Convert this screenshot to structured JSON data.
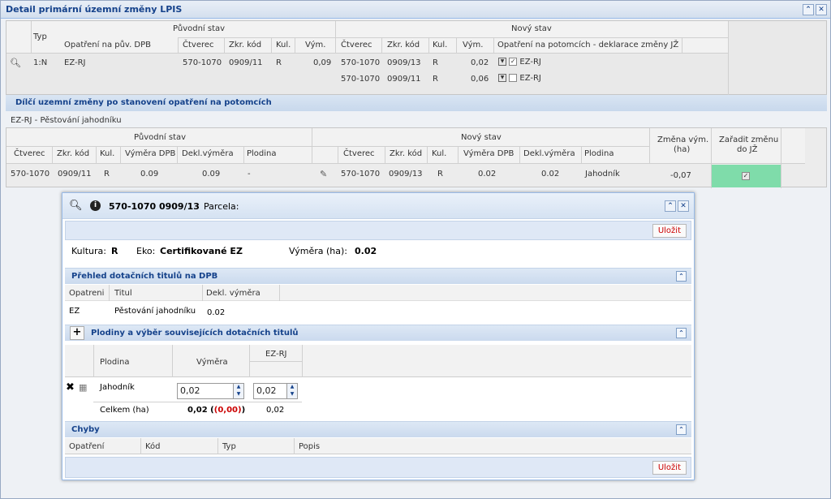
{
  "window": {
    "title": "Detail primární územní změny LPIS"
  },
  "top": {
    "group_original": "Původní stav",
    "group_new": "Nový stav",
    "headers": {
      "typ": "Typ",
      "measure": "Opatření na pův. DPB",
      "ctverec": "Čtverec",
      "zkr": "Zkr. kód",
      "kul": "Kul.",
      "vym": "Vým.",
      "ctverec2": "Čtverec",
      "zkr2": "Zkr. kód",
      "kul2": "Kul.",
      "vym2": "Vým.",
      "measure2": "Opatření na potomcích - deklarace změny JŽ"
    },
    "row": {
      "typ": "1:N",
      "measure": "EZ-RJ",
      "ctverec": "570-1070",
      "zkr": "0909/11",
      "kul": "R",
      "vym": "0,09"
    },
    "children": [
      {
        "ctverec": "570-1070",
        "zkr": "0909/13",
        "kul": "R",
        "vym": "0,02",
        "checked": "✓",
        "label": "EZ-RJ"
      },
      {
        "ctverec": "570-1070",
        "zkr": "0909/11",
        "kul": "R",
        "vym": "0,06",
        "checked": "",
        "label": "EZ-RJ"
      }
    ]
  },
  "sub": {
    "band": "Dílčí uzemní změny po stanovení opatření na potomcích",
    "title": "EZ-RJ - Pěstování jahodníku",
    "group_original": "Původní stav",
    "group_new": "Nový stav",
    "change_label_1": "Změna vým.",
    "change_label_2": "(ha)",
    "assign_label_1": "Zařadit změnu",
    "assign_label_2": "do JŽ",
    "headers": {
      "ctverec": "Čtverec",
      "zkr": "Zkr. kód",
      "kul": "Kul.",
      "vymdpb": "Výměra DPB",
      "dekl": "Dekl.výměra",
      "plodina": "Plodina",
      "ctverec2": "Čtverec",
      "zkr2": "Zkr. kód",
      "kul2": "Kul.",
      "vymdpb2": "Výměra DPB",
      "dekl2": "Dekl.výměra",
      "plodina2": "Plodina"
    },
    "row": {
      "ctverec": "570-1070",
      "zkr": "0909/11",
      "kul": "R",
      "vymdpb": "0.09",
      "dekl": "0.09",
      "plodina": "-",
      "ctverec2": "570-1070",
      "zkr2": "0909/13",
      "kul2": "R",
      "vymdpb2": "0.02",
      "dekl2": "0.02",
      "plodina2": "Jahodník",
      "change": "-0,07",
      "assign": "✓"
    }
  },
  "dialog": {
    "title": "570-1070 0909/13",
    "parcela": "Parcela:",
    "save": "Uložit",
    "kultura_label": "Kultura:",
    "kultura": "R",
    "eko_label": "Eko:",
    "eko": "Certifikované EZ",
    "vymera_label": "Výměra (ha):",
    "vymera": "0.02",
    "sec1": "Přehled dotačních titulů na DPB",
    "t1_headers": {
      "opatreni": "Opatreni",
      "titul": "Titul",
      "dekl": "Dekl. výměra"
    },
    "t1_row": {
      "opatreni": "EZ",
      "titul": "Pěstování jahodníku",
      "dekl": "0.02"
    },
    "sec2": "Plodiny a výběr souvisejících dotačních titulů",
    "t2_headers": {
      "plodina": "Plodina",
      "vymera": "Výměra",
      "ezrj": "EZ-RJ"
    },
    "t2_row": {
      "plodina": "Jahodník",
      "vymera": "0,02",
      "ezrj": "0,02"
    },
    "total": {
      "label": "Celkem (ha)",
      "value": "0,02",
      "diff": "(0,00)",
      "ezrj": "0,02"
    },
    "sec3": "Chyby",
    "t3_headers": {
      "opatreni": "Opatření",
      "kod": "Kód",
      "typ": "Typ",
      "popis": "Popis"
    },
    "save2": "Uložit"
  },
  "colors": {
    "accent": "#15428b",
    "assign_bg": "#7fdcaa",
    "error": "#cc0000"
  }
}
